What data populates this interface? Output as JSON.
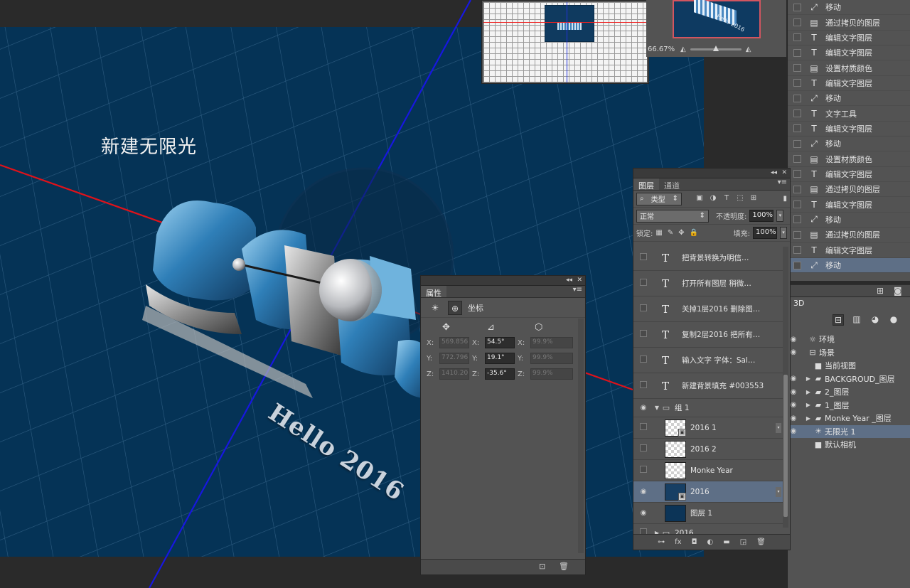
{
  "canvas": {
    "scene_label": "新建无限光",
    "hello_text": "Hello 2016"
  },
  "navigator": {
    "zoom": "66.67%",
    "zoom_level": 0.5,
    "preview_text": "Hello 2016"
  },
  "history": {
    "items": [
      {
        "icon": "move-icon",
        "glyph": "⤢",
        "label": "移动"
      },
      {
        "icon": "document-icon",
        "glyph": "▤",
        "label": "通过拷贝的图层"
      },
      {
        "icon": "type-icon",
        "glyph": "T",
        "label": "编辑文字图层"
      },
      {
        "icon": "type-icon",
        "glyph": "T",
        "label": "编辑文字图层"
      },
      {
        "icon": "document-icon",
        "glyph": "▤",
        "label": "设置材质颜色"
      },
      {
        "icon": "type-icon",
        "glyph": "T",
        "label": "编辑文字图层"
      },
      {
        "icon": "move-icon",
        "glyph": "⤢",
        "label": "移动"
      },
      {
        "icon": "type-icon",
        "glyph": "T",
        "label": "文字工具"
      },
      {
        "icon": "type-icon",
        "glyph": "T",
        "label": "编辑文字图层"
      },
      {
        "icon": "move-icon",
        "glyph": "⤢",
        "label": "移动"
      },
      {
        "icon": "document-icon",
        "glyph": "▤",
        "label": "设置材质颜色"
      },
      {
        "icon": "type-icon",
        "glyph": "T",
        "label": "编辑文字图层"
      },
      {
        "icon": "document-icon",
        "glyph": "▤",
        "label": "通过拷贝的图层"
      },
      {
        "icon": "type-icon",
        "glyph": "T",
        "label": "编辑文字图层"
      },
      {
        "icon": "move-icon",
        "glyph": "⤢",
        "label": "移动"
      },
      {
        "icon": "document-icon",
        "glyph": "▤",
        "label": "通过拷贝的图层"
      },
      {
        "icon": "type-icon",
        "glyph": "T",
        "label": "编辑文字图层"
      },
      {
        "icon": "move-icon",
        "glyph": "⤢",
        "label": "移动",
        "selected": true
      }
    ]
  },
  "panel3d": {
    "tab": "3D",
    "tree": [
      {
        "label": "环境",
        "icon": "environment-icon",
        "glyph": "☼",
        "eye": true,
        "indent": 0,
        "arrow": ""
      },
      {
        "label": "场景",
        "icon": "scene-icon",
        "glyph": "⊟",
        "eye": true,
        "indent": 0,
        "arrow": ""
      },
      {
        "label": "当前视图",
        "icon": "camera-icon",
        "glyph": "■",
        "eye": false,
        "indent": 1,
        "arrow": ""
      },
      {
        "label": "BACKGROUD_图层",
        "icon": "folder-icon",
        "glyph": "▰",
        "eye": true,
        "indent": 1,
        "arrow": "▶"
      },
      {
        "label": "2_图层",
        "icon": "folder-icon",
        "glyph": "▰",
        "eye": true,
        "indent": 1,
        "arrow": "▶"
      },
      {
        "label": "1_图层",
        "icon": "folder-icon",
        "glyph": "▰",
        "eye": true,
        "indent": 1,
        "arrow": "▶"
      },
      {
        "label": "Monke Year _图层",
        "icon": "folder-icon",
        "glyph": "▰",
        "eye": true,
        "indent": 1,
        "arrow": "▶"
      },
      {
        "label": "无限光 1",
        "icon": "light-icon",
        "glyph": "☀",
        "eye": true,
        "indent": 1,
        "arrow": "",
        "selected": true
      },
      {
        "label": "默认相机",
        "icon": "camera-icon",
        "glyph": "■",
        "eye": false,
        "indent": 1,
        "arrow": ""
      }
    ]
  },
  "properties": {
    "tab": "属性",
    "section": "坐标",
    "rows": [
      {
        "pos_label": "X:",
        "pos": "569.856",
        "rot_label": "X:",
        "rot": "54.5°",
        "scale_label": "X:",
        "scale": "99.9%"
      },
      {
        "pos_label": "Y:",
        "pos": "772.796",
        "rot_label": "Y:",
        "rot": "19.1°",
        "scale_label": "Y:",
        "scale": "99.9%"
      },
      {
        "pos_label": "Z:",
        "pos": "1410.20",
        "rot_label": "Z:",
        "rot": "-35.6°",
        "scale_label": "Z:",
        "scale": "99.9%"
      }
    ]
  },
  "layers": {
    "tabs": [
      "图层",
      "通道"
    ],
    "filter": "类型",
    "blend_mode": "正常",
    "opacity_label": "不透明度:",
    "opacity": "100%",
    "lock_label": "锁定:",
    "fill_label": "填充:",
    "fill": "100%",
    "items": [
      {
        "kind": "text",
        "label": "把背景转换为明信…",
        "visible": false
      },
      {
        "kind": "text",
        "label": "打开所有图层 稍微…",
        "visible": false
      },
      {
        "kind": "text",
        "label": "关掉1层2016 删除图…",
        "visible": false
      },
      {
        "kind": "text",
        "label": "复制2层2016 把所有…",
        "visible": false
      },
      {
        "kind": "text",
        "label": "输入文字 字体：Sal…",
        "visible": false
      },
      {
        "kind": "text",
        "label": "新建背景填充 #003553",
        "visible": false
      },
      {
        "kind": "group",
        "label": "组 1",
        "visible": true,
        "expanded": true
      },
      {
        "kind": "transparent3d",
        "label": "2016 1",
        "visible": false
      },
      {
        "kind": "transparent",
        "label": "2016 2",
        "visible": false
      },
      {
        "kind": "transparent",
        "label": "Monke Year",
        "visible": false
      },
      {
        "kind": "object",
        "label": "2016",
        "visible": true,
        "selected": true
      },
      {
        "kind": "navy",
        "label": "图层 1",
        "visible": true
      },
      {
        "kind": "group",
        "label": "2016",
        "visible": false,
        "expanded": false
      }
    ]
  }
}
